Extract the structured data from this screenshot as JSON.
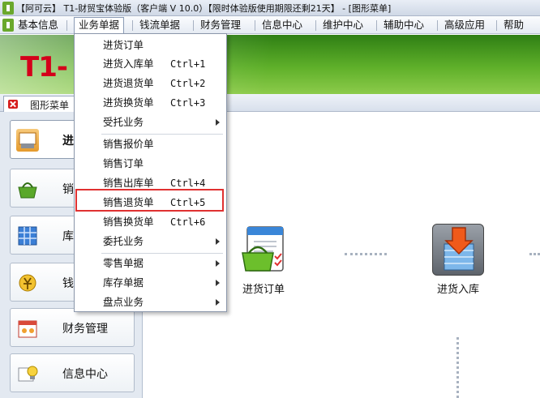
{
  "window": {
    "title": "【阿可云】 T1-财贸宝体验版（客户端 V 10.0）【限时体验版使用期限还剩21天】 - [图形菜单]"
  },
  "menubar": {
    "items": [
      "基本信息",
      "业务单据",
      "钱流单据",
      "财务管理",
      "信息中心",
      "维护中心",
      "辅助中心",
      "高级应用",
      "帮助"
    ]
  },
  "banner": {
    "logo_main": "T1",
    "logo_tail": "-"
  },
  "tabs": [
    {
      "label": "图形菜单"
    }
  ],
  "sidebar": {
    "items": [
      {
        "label": "进",
        "icon": "purchase-icon"
      },
      {
        "label": "销",
        "icon": "sales-basket-icon"
      },
      {
        "label": "库",
        "icon": "inventory-grid-icon"
      },
      {
        "label": "钱",
        "icon": "money-icon"
      },
      {
        "label": "财务管理",
        "icon": "finance-calendar-icon"
      },
      {
        "label": "信息中心",
        "icon": "info-bulb-icon"
      }
    ]
  },
  "main": {
    "features": [
      {
        "label": "进货订单",
        "icon": "purchase-order-icon"
      },
      {
        "label": "进货入库",
        "icon": "warehouse-in-icon"
      }
    ]
  },
  "dropdown": {
    "items": [
      {
        "label": "进货订单",
        "shortcut": ""
      },
      {
        "label": "进货入库单",
        "shortcut": "Ctrl+1"
      },
      {
        "label": "进货退货单",
        "shortcut": "Ctrl+2"
      },
      {
        "label": "进货换货单",
        "shortcut": "Ctrl+3"
      },
      {
        "label": "受托业务",
        "shortcut": ""
      },
      {
        "label": "销售报价单",
        "shortcut": ""
      },
      {
        "label": "销售订单",
        "shortcut": ""
      },
      {
        "label": "销售出库单",
        "shortcut": "Ctrl+4"
      },
      {
        "label": "销售退货单",
        "shortcut": "Ctrl+5"
      },
      {
        "label": "销售换货单",
        "shortcut": "Ctrl+6"
      },
      {
        "label": "委托业务",
        "shortcut": ""
      },
      {
        "label": "零售单据",
        "shortcut": ""
      },
      {
        "label": "库存单据",
        "shortcut": ""
      },
      {
        "label": "盘点业务",
        "shortcut": ""
      }
    ]
  },
  "colors": {
    "highlight": "#e03131",
    "banner": "#5fb02a",
    "logo_red": "#d4001a"
  }
}
